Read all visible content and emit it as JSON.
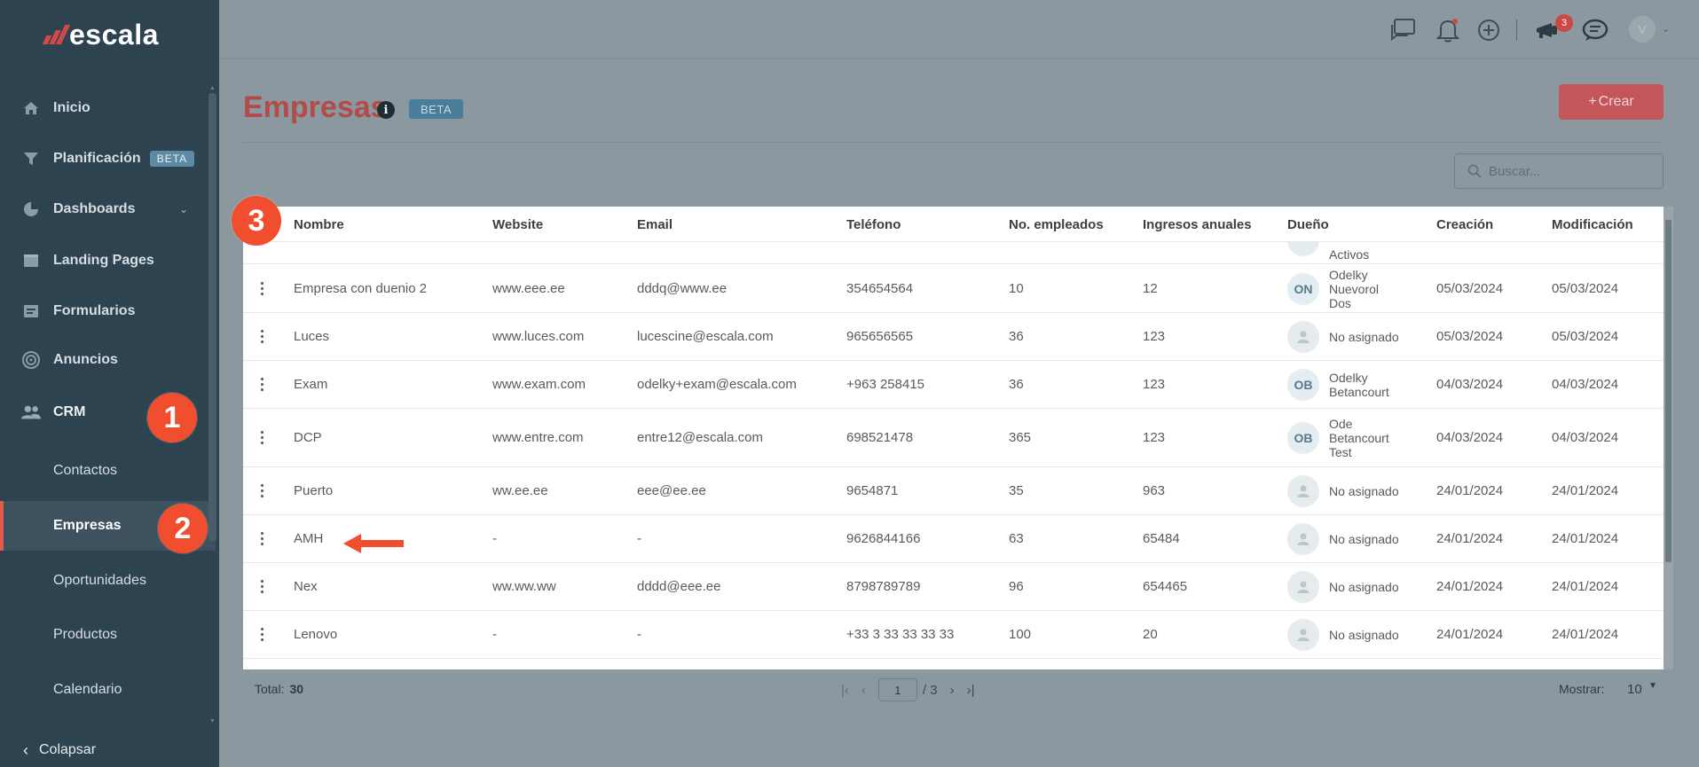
{
  "app": {
    "logo_text": "escala"
  },
  "sidebar": {
    "items": [
      {
        "label": "Inicio",
        "icon": "home-icon"
      },
      {
        "label": "Planificación",
        "badge": "BETA",
        "icon": "funnel-icon"
      },
      {
        "label": "Dashboards",
        "icon": "pie-chart-icon"
      },
      {
        "label": "Landing Pages",
        "icon": "browser-icon"
      },
      {
        "label": "Formularios",
        "icon": "form-icon"
      },
      {
        "label": "Anuncios",
        "icon": "target-icon"
      },
      {
        "label": "CRM",
        "icon": "users-icon"
      }
    ],
    "crm_sub": [
      {
        "label": "Contactos"
      },
      {
        "label": "Empresas",
        "active": true
      },
      {
        "label": "Oportunidades"
      },
      {
        "label": "Productos"
      },
      {
        "label": "Calendario"
      }
    ],
    "collapse_label": "Colapsar"
  },
  "topbar": {
    "notification_count": "3",
    "avatar_initial": "V"
  },
  "page": {
    "title": "Empresas",
    "badge": "BETA",
    "create_label": "Crear",
    "search_placeholder": "Buscar..."
  },
  "table": {
    "columns": [
      "Nombre",
      "Website",
      "Email",
      "Teléfono",
      "No. empleados",
      "Ingresos anuales",
      "Dueño",
      "Creación",
      "Modificación"
    ],
    "partial_owner": "Activos",
    "rows": [
      {
        "name": "Empresa con duenio 2",
        "website": "www.eee.ee",
        "email": "dddq@www.ee",
        "phone": "354654564",
        "employees": "10",
        "revenue": "12",
        "owner_initials": "ON",
        "owner": "Odelky Nuevorol Dos",
        "created": "05/03/2024",
        "modified": "05/03/2024"
      },
      {
        "name": "Luces",
        "website": "www.luces.com",
        "email": "lucescine@escala.com",
        "phone": "965656565",
        "employees": "36",
        "revenue": "123",
        "owner_initials": "",
        "owner": "No asignado",
        "created": "05/03/2024",
        "modified": "05/03/2024"
      },
      {
        "name": "Exam",
        "website": "www.exam.com",
        "email": "odelky+exam@escala.com",
        "phone": "+963 258415",
        "employees": "36",
        "revenue": "123",
        "owner_initials": "OB",
        "owner": "Odelky Betancourt",
        "created": "04/03/2024",
        "modified": "04/03/2024"
      },
      {
        "name": "DCP",
        "website": "www.entre.com",
        "email": "entre12@escala.com",
        "phone": "698521478",
        "employees": "365",
        "revenue": "123",
        "owner_initials": "OB",
        "owner": "Ode Betancourt Test",
        "created": "04/03/2024",
        "modified": "04/03/2024"
      },
      {
        "name": "Puerto",
        "website": "ww.ee.ee",
        "email": "eee@ee.ee",
        "phone": "9654871",
        "employees": "35",
        "revenue": "963",
        "owner_initials": "",
        "owner": "No asignado",
        "created": "24/01/2024",
        "modified": "24/01/2024"
      },
      {
        "name": "AMH",
        "website": "-",
        "email": "-",
        "phone": "9626844166",
        "employees": "63",
        "revenue": "65484",
        "owner_initials": "",
        "owner": "No asignado",
        "created": "24/01/2024",
        "modified": "24/01/2024"
      },
      {
        "name": "Nex",
        "website": "ww.ww.ww",
        "email": "dddd@eee.ee",
        "phone": "8798789789",
        "employees": "96",
        "revenue": "654465",
        "owner_initials": "",
        "owner": "No asignado",
        "created": "24/01/2024",
        "modified": "24/01/2024"
      },
      {
        "name": "Lenovo",
        "website": "-",
        "email": "-",
        "phone": "+33 3 33 33 33 33",
        "employees": "100",
        "revenue": "20",
        "owner_initials": "",
        "owner": "No asignado",
        "created": "24/01/2024",
        "modified": "24/01/2024"
      }
    ]
  },
  "footer": {
    "total_label": "Total:",
    "total_value": "30",
    "current_page": "1",
    "page_of": "/ 3",
    "show_label": "Mostrar:",
    "show_value": "10"
  },
  "annotations": {
    "step1": "1",
    "step2": "2",
    "step3": "3"
  },
  "colors": {
    "sidebar": "#2d4350",
    "accent": "#e05a4e",
    "title": "#b24c49",
    "step_badge": "#f04e2e",
    "overlay": "#8b989f"
  }
}
